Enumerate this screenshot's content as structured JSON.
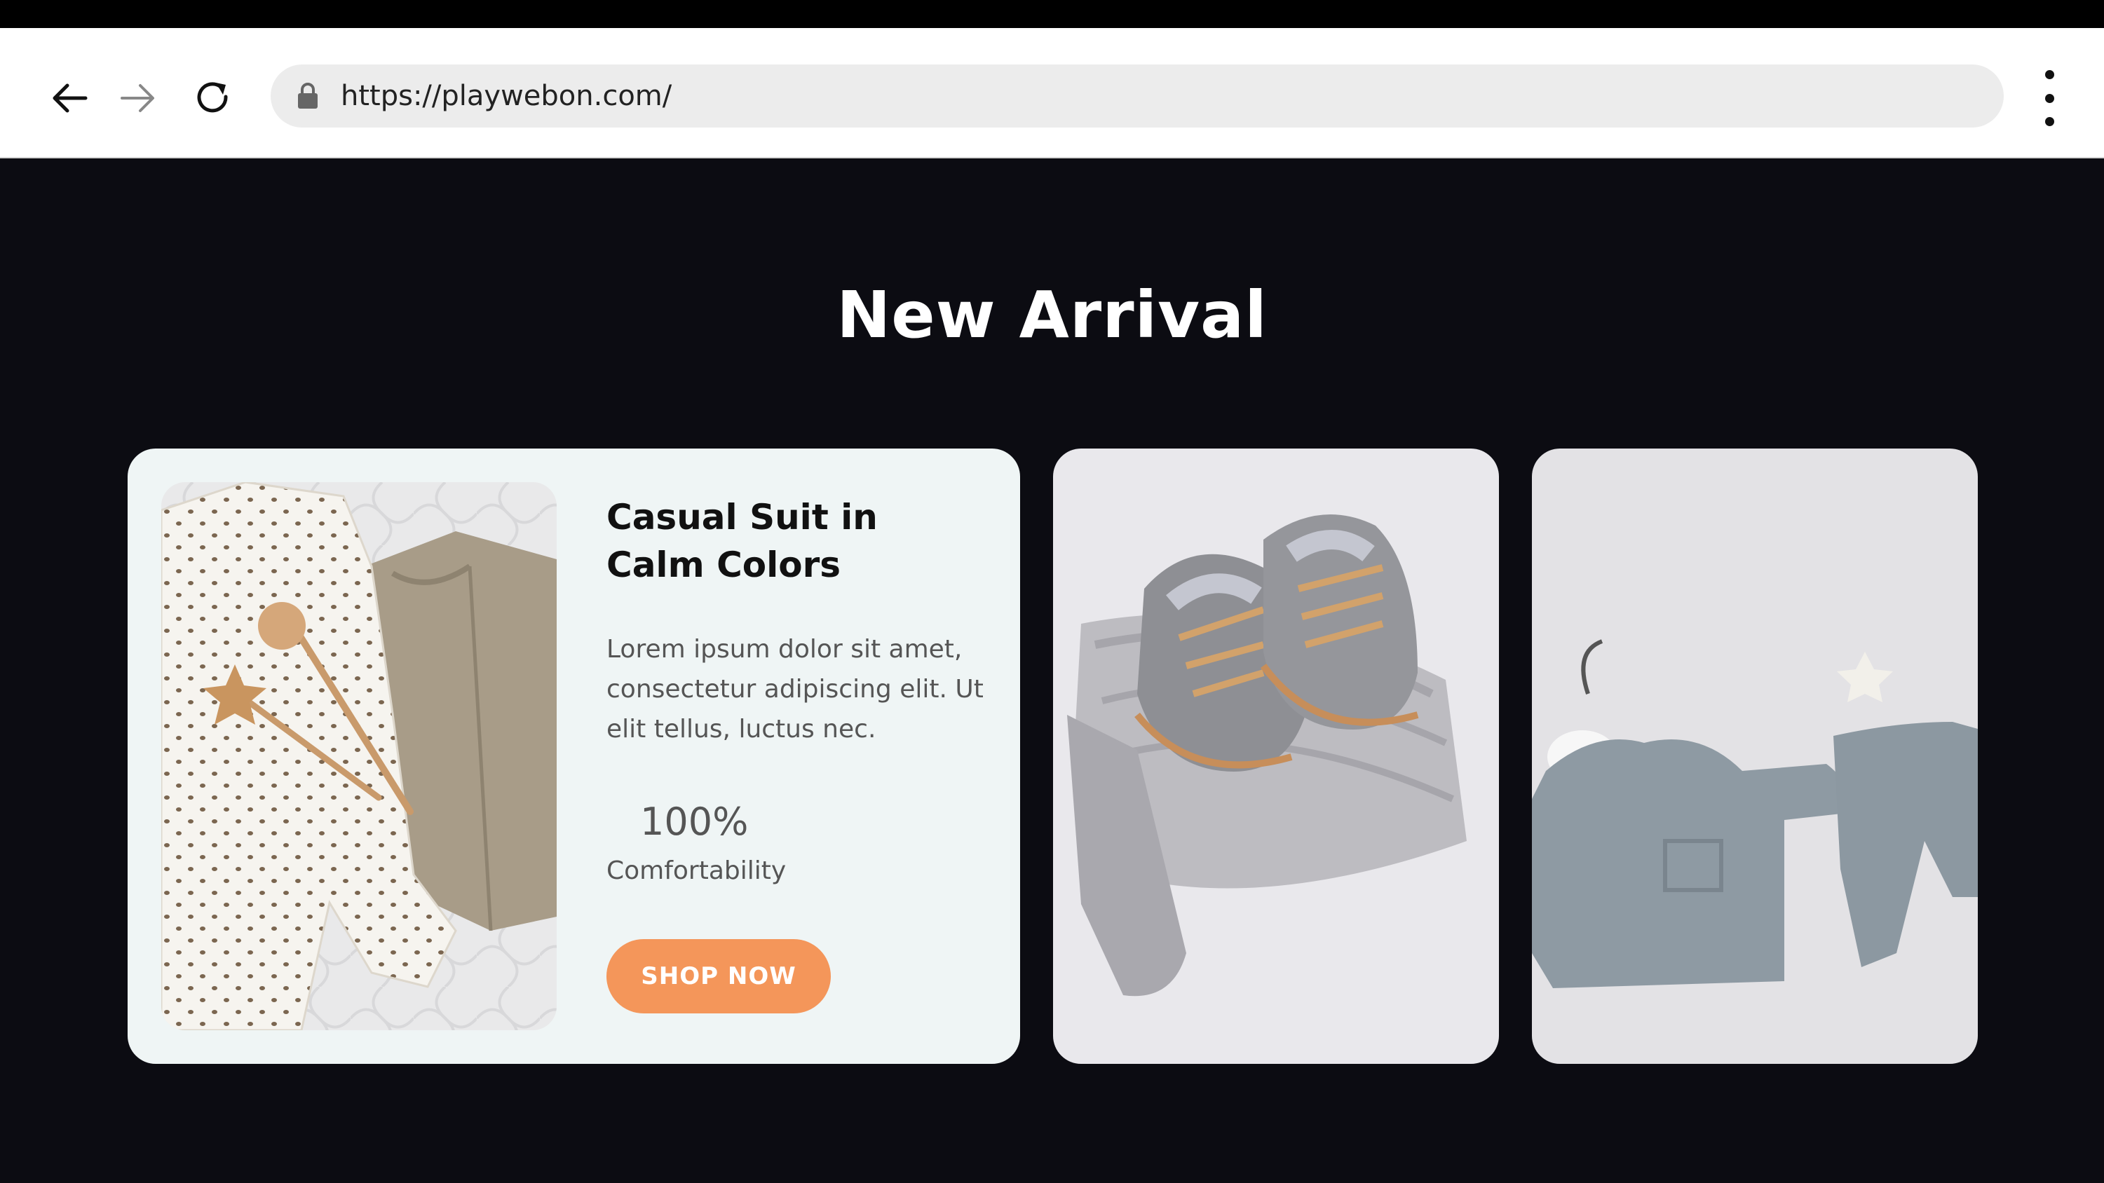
{
  "browser": {
    "url": "https://playwebon.com/",
    "back_icon": "arrow-left-icon",
    "forward_icon": "arrow-right-icon",
    "reload_icon": "reload-icon",
    "menu_icon": "kebab-menu-icon"
  },
  "section": {
    "title": "New Arrival"
  },
  "featured": {
    "title": "Casual Suit in Calm Colors",
    "description": "Lorem ipsum dolor sit amet, consectetur adipiscing elit. Ut elit tellus, luctus nec.",
    "stat_value": "100%",
    "stat_label": "Comfortability",
    "button_label": "SHOP NOW",
    "button_color": "#f4965a"
  },
  "colors": {
    "page_bg": "#0c0c12",
    "card_bg": "#eff5f5",
    "accent": "#f4965a"
  }
}
